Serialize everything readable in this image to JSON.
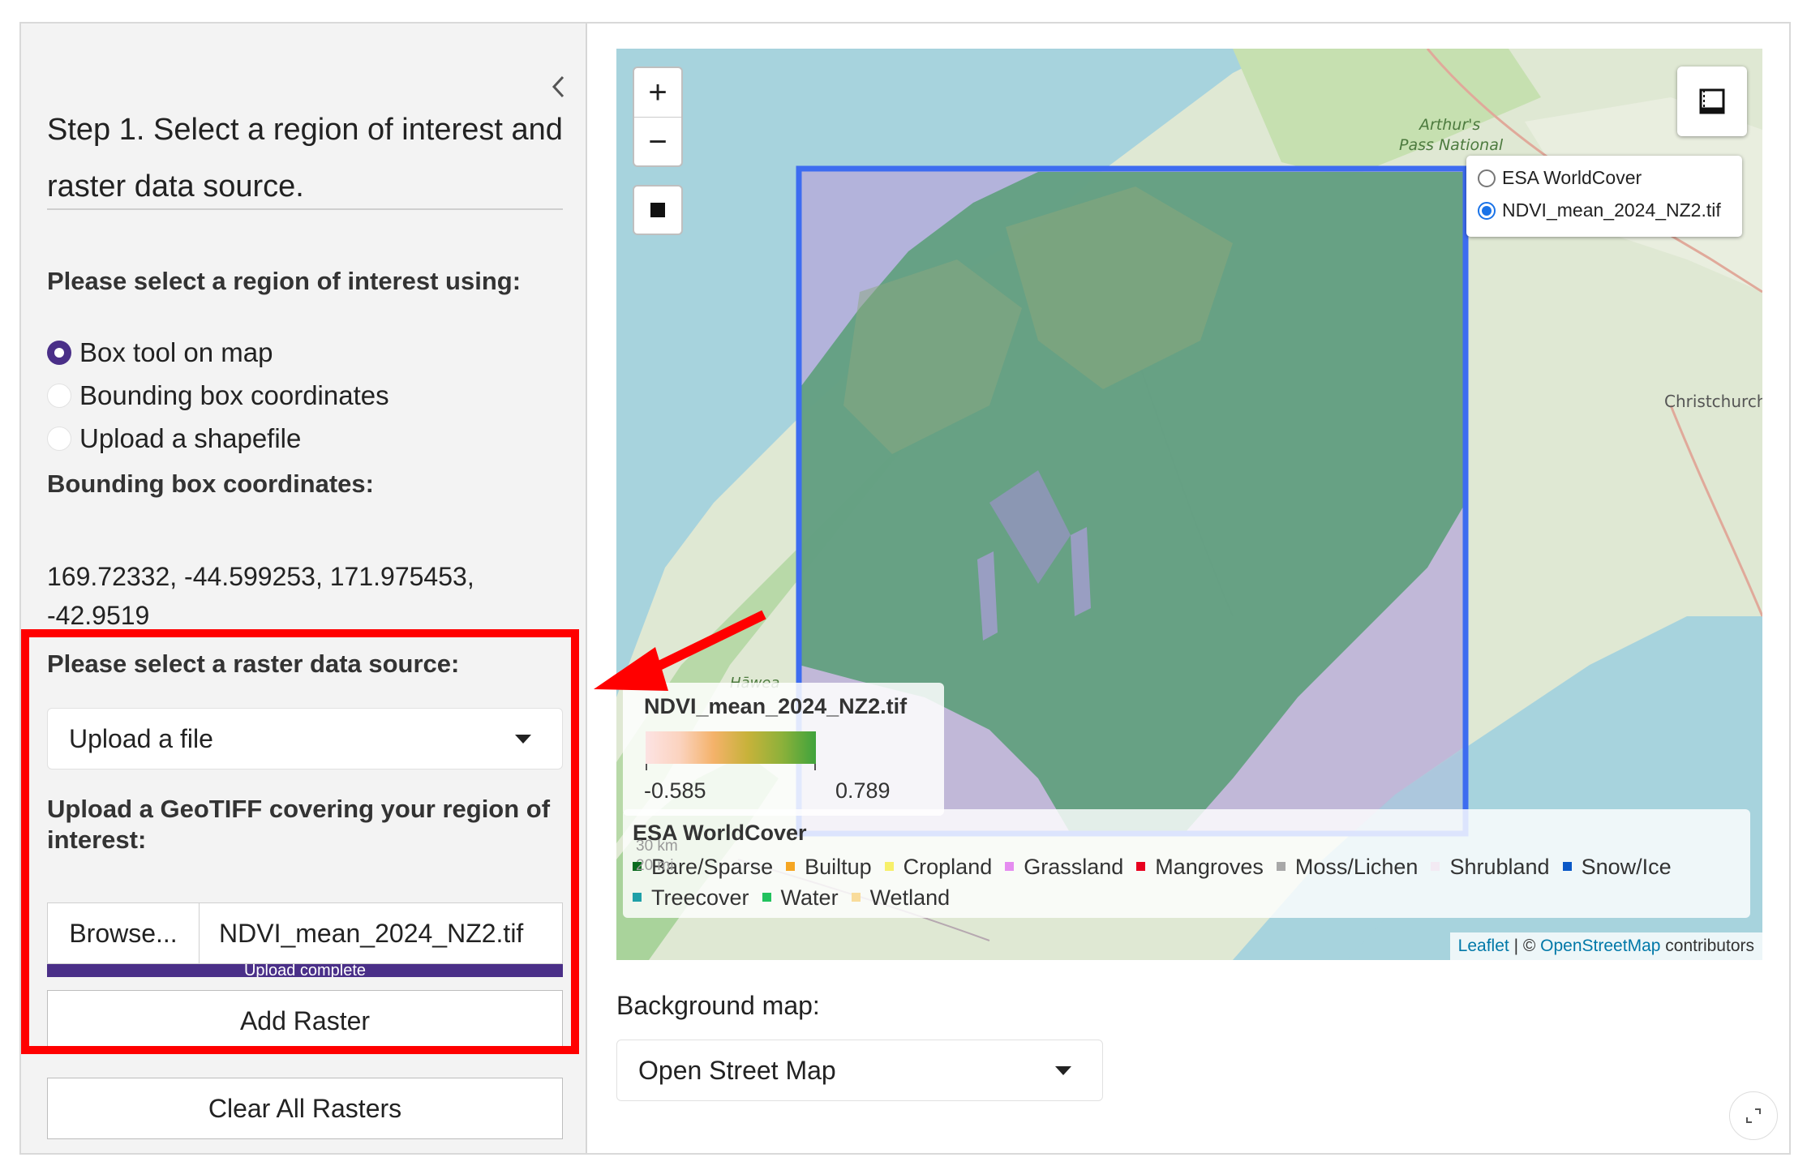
{
  "sidebar": {
    "title": "Step 1. Select a region of interest and raster data source.",
    "roi_label": "Please select a region of interest using:",
    "roi_options": [
      {
        "label": "Box tool on map",
        "selected": true
      },
      {
        "label": "Bounding box coordinates",
        "selected": false
      },
      {
        "label": "Upload a shapefile",
        "selected": false
      }
    ],
    "bbox_label": "Bounding box coordinates:",
    "bbox_value": "169.72332, -44.599253, 171.975453, -42.9519",
    "raster_source_label": "Please select a raster data source:",
    "raster_source_value": "Upload a file",
    "upload_label": "Upload a GeoTIFF covering your region of interest:",
    "browse_label": "Browse...",
    "file_name": "NDVI_mean_2024_NZ2.tif",
    "upload_status": "Upload complete",
    "upload_progress_percent": 100,
    "add_raster_label": "Add Raster",
    "clear_rasters_label": "Clear All Rasters"
  },
  "map": {
    "zoom_in": "+",
    "zoom_out": "−",
    "layers": [
      {
        "label": "ESA WorldCover",
        "selected": false
      },
      {
        "label": "NDVI_mean_2024_NZ2.tif",
        "selected": true
      }
    ],
    "place_labels": [
      "Arthur's",
      "Pass National",
      "Christchurch",
      "Hāwea"
    ],
    "ndvi_legend": {
      "title": "NDVI_mean_2024_NZ2.tif",
      "min": "-0.585",
      "max": "0.789"
    },
    "worldcover_legend": {
      "title": "ESA WorldCover",
      "items": [
        {
          "label": "Bare/Sparse",
          "color": "#0b6b1f"
        },
        {
          "label": "Builtup",
          "color": "#f5a623"
        },
        {
          "label": "Cropland",
          "color": "#f7f06a"
        },
        {
          "label": "Grassland",
          "color": "#e58cf0"
        },
        {
          "label": "Mangroves",
          "color": "#e8001e"
        },
        {
          "label": "Moss/Lichen",
          "color": "#a8a8a8"
        },
        {
          "label": "Shrubland",
          "color": "#f3eaf3"
        },
        {
          "label": "Snow/Ice",
          "color": "#0a58c7"
        },
        {
          "label": "Treecover",
          "color": "#1fa0a8"
        },
        {
          "label": "Water",
          "color": "#22c25e"
        },
        {
          "label": "Wetland",
          "color": "#f9dc9b"
        }
      ]
    },
    "scale_km": "30 km",
    "scale_mi": "20 mi",
    "attribution": {
      "leaflet": "Leaflet",
      "separator": " | © ",
      "osm": "OpenStreetMap",
      "suffix": " contributors"
    }
  },
  "background_map": {
    "label": "Background map:",
    "value": "Open Street Map"
  },
  "colors": {
    "accent": "#4a2f88",
    "highlight": "#ff0000",
    "bbox": "#3d6cf0"
  }
}
